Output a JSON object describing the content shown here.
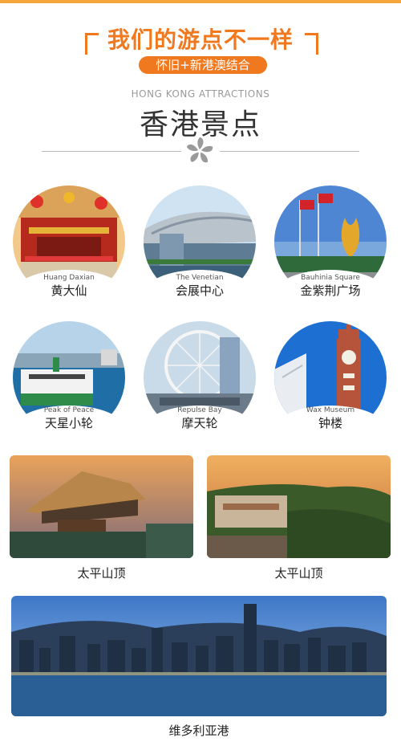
{
  "header": {
    "title": "我们的游点不一样",
    "tagline": "怀旧+新港澳结合"
  },
  "section": {
    "english_title": "HONG KONG ATTRACTIONS",
    "title": "香港景点"
  },
  "round_cards": [
    {
      "en": "Huang Daxian",
      "cn": "黄大仙"
    },
    {
      "en": "The Venetian",
      "cn": "会展中心"
    },
    {
      "en": "Bauhinia Square",
      "cn": "金紫荆广场"
    },
    {
      "en": "Peak of Peace",
      "cn": "天星小轮"
    },
    {
      "en": "Repulse Bay",
      "cn": "摩天轮"
    },
    {
      "en": "Wax Museum",
      "cn": "钟楼"
    }
  ],
  "rect_cards": [
    {
      "label": "太平山顶"
    },
    {
      "label": "太平山顶"
    }
  ],
  "wide_card": {
    "label": "维多利亚港"
  },
  "colors": {
    "accent": "#f0781e",
    "text": "#222222",
    "muted": "#9a9a9a"
  }
}
